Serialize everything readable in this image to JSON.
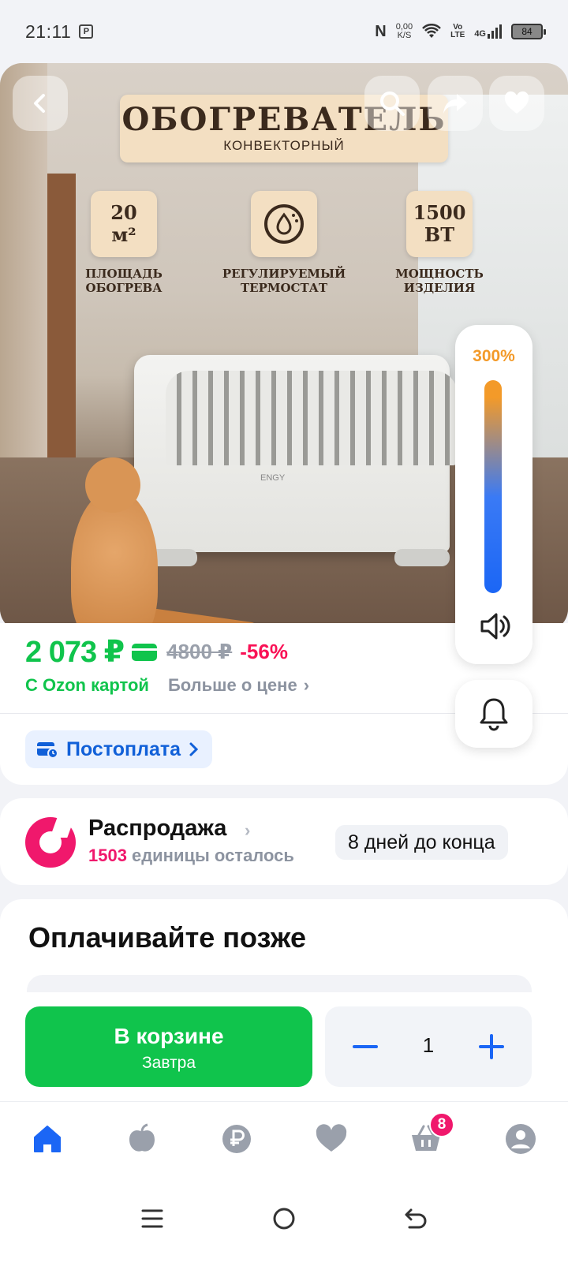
{
  "status_bar": {
    "time": "21:11",
    "net_speed_value": "0,00",
    "net_speed_unit": "K/S",
    "volte_top": "Vo",
    "volte_bottom": "LTE",
    "network": "4G",
    "battery": "84"
  },
  "hero": {
    "title": "ОБОГРЕВАТЕЛЬ",
    "subtitle": "КОНВЕКТОРНЫЙ",
    "features": [
      {
        "value": "20 м²",
        "label": "ПЛОЩАДЬ\nОБОГРЕВА"
      },
      {
        "value": "",
        "label": "РЕГУЛИРУЕМЫЙ\nТЕРМОСТАТ",
        "icon": "thermostat-icon"
      },
      {
        "value": "1500 ВТ",
        "label": "МОЩНОСТЬ\nИЗДЕЛИЯ"
      }
    ],
    "heater_brand": "ENGY"
  },
  "volume": {
    "percent_label": "300%",
    "level_fraction": 1.0
  },
  "price": {
    "current": "2 073 ₽",
    "old": "4800 ₽",
    "discount": "-56%",
    "card_label": "С Ozon картой",
    "more_label": "Больше о цене"
  },
  "postpay": {
    "label": "Постоплата"
  },
  "sale": {
    "title": "Распродажа",
    "count": "1503",
    "count_suffix": "единицы осталось",
    "deadline": "8 дней до конца"
  },
  "pay_later": {
    "title": "Оплачивайте позже"
  },
  "buy": {
    "cart_label": "В корзине",
    "cart_sub": "Завтра",
    "quantity": "1"
  },
  "bottom_nav": {
    "cart_badge": "8"
  },
  "colors": {
    "green": "#10c44c",
    "pink": "#f0186c",
    "blue": "#1b66f5",
    "orange": "#f39a29"
  }
}
